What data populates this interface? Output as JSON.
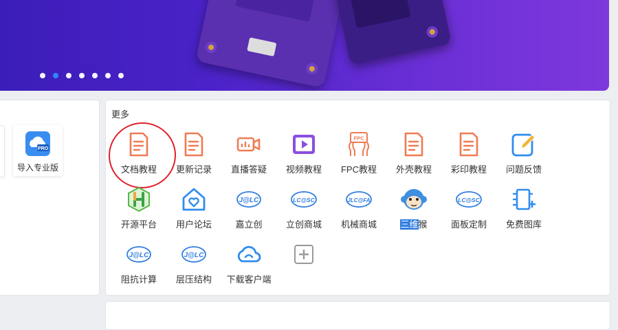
{
  "banner": {
    "carousel_count": 7,
    "active_index": 1
  },
  "left_panel": {
    "pro_tile_label": "导入专业版",
    "pro_badge": "PRO"
  },
  "more": {
    "title": "更多",
    "items": [
      {
        "label": "文档教程",
        "icon": "document-icon"
      },
      {
        "label": "更新记录",
        "icon": "changelog-icon"
      },
      {
        "label": "直播答疑",
        "icon": "live-camera-icon"
      },
      {
        "label": "视频教程",
        "icon": "video-play-icon"
      },
      {
        "label": "FPC教程",
        "icon": "fpc-icon"
      },
      {
        "label": "外壳教程",
        "icon": "document-icon"
      },
      {
        "label": "彩印教程",
        "icon": "document-icon"
      },
      {
        "label": "问题反馈",
        "icon": "edit-feedback-icon"
      },
      {
        "label": "开源平台",
        "icon": "oshw-icon"
      },
      {
        "label": "用户论坛",
        "icon": "home-heart-icon"
      },
      {
        "label": "嘉立创",
        "icon": "jlc-logo-icon"
      },
      {
        "label": "立创商城",
        "icon": "lcsc-logo-icon"
      },
      {
        "label": "机械商城",
        "icon": "jlcfa-logo-icon"
      },
      {
        "label_highlight": "三维",
        "label_rest": "猴",
        "icon": "monkey-mascot-icon"
      },
      {
        "label": "面板定制",
        "icon": "lcsc-logo-icon"
      },
      {
        "label": "免费图库",
        "icon": "component-library-icon"
      },
      {
        "label": "阻抗计算",
        "icon": "jlc-logo-icon"
      },
      {
        "label": "层压结构",
        "icon": "jlc-logo-icon"
      },
      {
        "label": "下载客户端",
        "icon": "cloud-download-icon"
      },
      {
        "label": "",
        "icon": "add-icon"
      }
    ],
    "logo_text": {
      "jlc": "J@LC",
      "lcsc": "LC@SC",
      "jlcfa": "JLC@FA",
      "fpc": "FPC"
    }
  }
}
